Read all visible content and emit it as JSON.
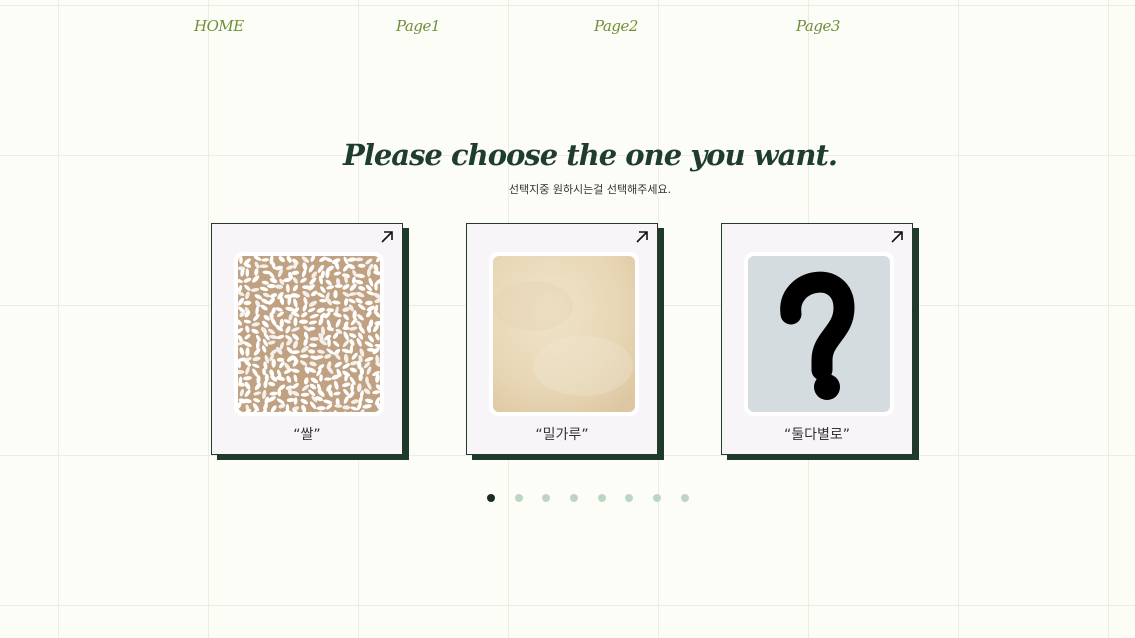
{
  "nav": {
    "items": [
      {
        "label": "HOME"
      },
      {
        "label": "Page1"
      },
      {
        "label": "Page2"
      },
      {
        "label": "Page3"
      }
    ]
  },
  "main": {
    "title": "Please choose the one you want.",
    "subtitle": "선택지중 원하시는걸 선택해주세요."
  },
  "cards": [
    {
      "caption": "“쌀”",
      "image": "rice-grains",
      "arrow_icon": "arrow-up-right-icon"
    },
    {
      "caption": "“밀가루”",
      "image": "flour-texture",
      "arrow_icon": "arrow-up-right-icon"
    },
    {
      "caption": "“둘다별로”",
      "image": "question-mark",
      "arrow_icon": "arrow-up-right-icon"
    }
  ],
  "pagination": {
    "count": 8,
    "active_index": 0
  },
  "colors": {
    "background": "#fdfdf7",
    "nav_text": "#6f8f3b",
    "title_text": "#1f3d2c",
    "card_shadow": "#1e3a2b",
    "card_background": "#f7f5f7",
    "dot_inactive": "#bcd6c6",
    "dot_active": "#1b2e22",
    "rice_background": "#c0a182",
    "flour_color": "#eadbbe",
    "question_background": "#d4dcdf"
  }
}
